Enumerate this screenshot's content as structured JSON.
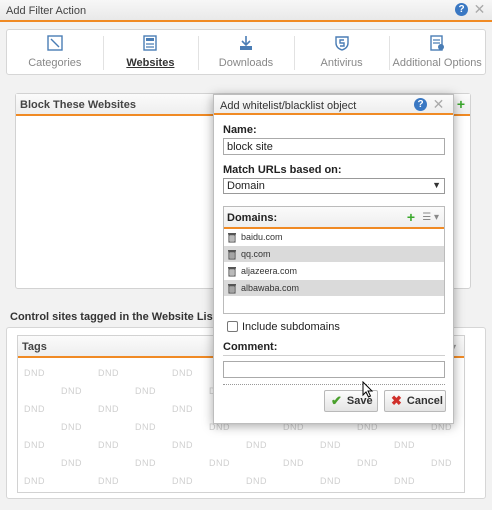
{
  "window": {
    "title": "Add Filter Action",
    "help": "?",
    "close": "✕"
  },
  "tabs": [
    {
      "label": "Categories",
      "active": false,
      "icon": "categories-icon"
    },
    {
      "label": "Websites",
      "active": true,
      "icon": "websites-icon"
    },
    {
      "label": "Downloads",
      "active": false,
      "icon": "downloads-icon"
    },
    {
      "label": "Antivirus",
      "active": false,
      "icon": "antivirus-icon"
    },
    {
      "label": "Additional Options",
      "active": false,
      "icon": "additional-options-icon"
    }
  ],
  "block_panel": {
    "title": "Block These Websites",
    "add": "+"
  },
  "website_list": {
    "section_label": "Control sites tagged in the Website List",
    "tags_title": "Tags",
    "placeholder": "DND"
  },
  "modal": {
    "title": "Add whitelist/blacklist object",
    "help": "?",
    "close": "✕",
    "name_label": "Name:",
    "name_value": "block site",
    "match_label": "Match URLs based on:",
    "match_value": "Domain",
    "domains_title": "Domains:",
    "domains_add": "+",
    "domains": [
      "baidu.com",
      "qq.com",
      "aljazeera.com",
      "albawaba.com"
    ],
    "include_subdomains_label": "Include subdomains",
    "include_subdomains_checked": false,
    "comment_label": "Comment:",
    "comment_value": "",
    "save_label": "Save",
    "cancel_label": "Cancel"
  },
  "colors": {
    "accent": "#f08a24",
    "help_blue": "#3a78c3",
    "add_green": "#3aa82c",
    "cancel_red": "#d0302b",
    "save_green": "#4aa02c"
  }
}
